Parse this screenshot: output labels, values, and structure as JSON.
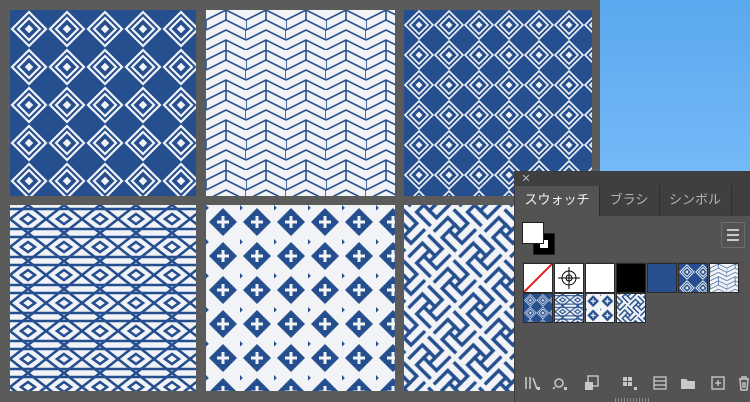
{
  "colors": {
    "navy": "#254f8e",
    "pattern_bg": "#f2f3f7",
    "panel_bg": "#535353",
    "panel_dark": "#3f3f3f",
    "canvas_blue": "#7fc0fb"
  },
  "artboards": [
    {
      "name": "diamond-lattice-pattern",
      "style": "diamond"
    },
    {
      "name": "zigzag-herringbone-pattern",
      "style": "zigzag"
    },
    {
      "name": "nested-diamond-pattern",
      "style": "nested-diamond"
    },
    {
      "name": "interlocking-diamond-pattern",
      "style": "interlock"
    },
    {
      "name": "cross-diamond-pattern",
      "style": "cross"
    },
    {
      "name": "sayagata-pattern",
      "style": "sayagata"
    }
  ],
  "panel": {
    "close_icon": "close-icon",
    "close_glyph": "✕",
    "tabs": [
      {
        "label": "スウォッチ",
        "active": true
      },
      {
        "label": "ブラシ",
        "active": false
      },
      {
        "label": "シンボル",
        "active": false
      }
    ],
    "menu_icon": "panel-menu-icon",
    "swatches": [
      {
        "name": "swatch-none",
        "type": "none"
      },
      {
        "name": "swatch-registration",
        "type": "registration"
      },
      {
        "name": "swatch-white",
        "type": "solid",
        "color": "#ffffff"
      },
      {
        "name": "swatch-black",
        "type": "solid",
        "color": "#000000"
      },
      {
        "name": "swatch-navy",
        "type": "solid",
        "color": "#254f8e"
      },
      {
        "name": "swatch-pattern-diamond",
        "type": "pattern",
        "style": "diamond"
      },
      {
        "name": "swatch-pattern-zigzag",
        "type": "pattern",
        "style": "zigzag"
      },
      {
        "name": "swatch-pattern-nested-diamond",
        "type": "pattern",
        "style": "nested-diamond"
      },
      {
        "name": "swatch-pattern-interlock",
        "type": "pattern",
        "style": "interlock"
      },
      {
        "name": "swatch-pattern-cross",
        "type": "pattern",
        "style": "cross"
      },
      {
        "name": "swatch-pattern-sayagata",
        "type": "pattern",
        "style": "sayagata"
      }
    ],
    "toolbar_icons": [
      "swatch-libraries-icon",
      "show-swatch-kinds-icon",
      "swatch-options-icon",
      "color-group-icon",
      "new-color-group-icon",
      "folder-icon",
      "new-swatch-icon",
      "delete-icon"
    ]
  }
}
